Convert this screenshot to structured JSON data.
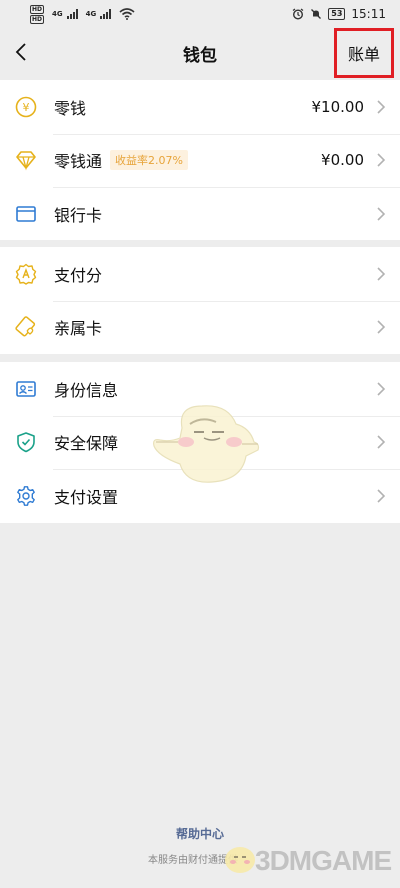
{
  "status_bar": {
    "hd1": "HD",
    "hd2": "HD",
    "net1": "4G",
    "net2": "4G",
    "battery": "53",
    "time": "15:11"
  },
  "nav": {
    "title": "钱包",
    "bill_label": "账单"
  },
  "colors": {
    "highlight_border": "#e01e24",
    "gold": "#e6b21b",
    "blue": "#2f7bd3",
    "teal": "#1aa189",
    "link": "#576b95"
  },
  "section1": [
    {
      "label": "零钱",
      "value": "¥10.00",
      "icon": "yuan-coin-icon"
    },
    {
      "label": "零钱通",
      "badge": "收益率2.07%",
      "value": "¥0.00",
      "icon": "diamond-icon"
    },
    {
      "label": "银行卡",
      "icon": "bank-card-icon"
    }
  ],
  "section2": [
    {
      "label": "支付分",
      "icon": "pay-score-icon"
    },
    {
      "label": "亲属卡",
      "icon": "family-card-icon"
    }
  ],
  "section3": [
    {
      "label": "身份信息",
      "icon": "id-card-icon"
    },
    {
      "label": "安全保障",
      "icon": "shield-icon"
    },
    {
      "label": "支付设置",
      "icon": "gear-icon"
    }
  ],
  "footer": {
    "help_center": "帮助中心",
    "service_text": "本服务由财付通提供"
  },
  "watermark": {
    "brand": "3DMGAME"
  }
}
